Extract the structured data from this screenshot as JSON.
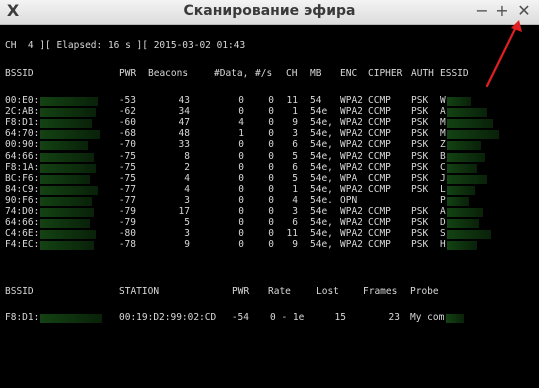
{
  "window": {
    "title": "Сканирование эфира",
    "app_icon": "X",
    "minimize": "−",
    "maximize": "+",
    "close": "✕"
  },
  "status_line": "CH  4 ][ Elapsed: 16 s ][ 2015-03-02 01:43",
  "ap_table": {
    "headers": [
      "BSSID",
      "PWR",
      "Beacons",
      "#Data,",
      "#/s",
      "CH",
      "MB",
      "ENC",
      "CIPHER",
      "AUTH",
      "ESSID"
    ],
    "rows": [
      {
        "bssid": "00:E0:",
        "pwr": "-53",
        "beacons": "43",
        "data": "0",
        "ps": "0",
        "ch": "11",
        "mb": "54",
        "enc": "WPA2",
        "cipher": "CCMP",
        "auth": "PSK",
        "essid": "W"
      },
      {
        "bssid": "2C:AB:",
        "pwr": "-62",
        "beacons": "34",
        "data": "0",
        "ps": "0",
        "ch": "1",
        "mb": "54e",
        "enc": "WPA2",
        "cipher": "CCMP",
        "auth": "PSK",
        "essid": "A"
      },
      {
        "bssid": "F8:D1:",
        "pwr": "-60",
        "beacons": "47",
        "data": "4",
        "ps": "0",
        "ch": "9",
        "mb": "54e,",
        "enc": "WPA2",
        "cipher": "CCMP",
        "auth": "PSK",
        "essid": "M"
      },
      {
        "bssid": "64:70:",
        "pwr": "-68",
        "beacons": "48",
        "data": "1",
        "ps": "0",
        "ch": "3",
        "mb": "54e,",
        "enc": "WPA2",
        "cipher": "CCMP",
        "auth": "PSK",
        "essid": "M"
      },
      {
        "bssid": "00:90:",
        "pwr": "-70",
        "beacons": "33",
        "data": "0",
        "ps": "0",
        "ch": "6",
        "mb": "54e,",
        "enc": "WPA2",
        "cipher": "CCMP",
        "auth": "PSK",
        "essid": "Z"
      },
      {
        "bssid": "64:66:",
        "pwr": "-75",
        "beacons": "8",
        "data": "0",
        "ps": "0",
        "ch": "5",
        "mb": "54e,",
        "enc": "WPA2",
        "cipher": "CCMP",
        "auth": "PSK",
        "essid": "B"
      },
      {
        "bssid": "F8:1A:",
        "pwr": "-75",
        "beacons": "2",
        "data": "0",
        "ps": "0",
        "ch": "6",
        "mb": "54e,",
        "enc": "WPA2",
        "cipher": "CCMP",
        "auth": "PSK",
        "essid": "C"
      },
      {
        "bssid": "BC:F6:",
        "pwr": "-75",
        "beacons": "4",
        "data": "0",
        "ps": "0",
        "ch": "5",
        "mb": "54e,",
        "enc": "WPA",
        "cipher": "CCMP",
        "auth": "PSK",
        "essid": "J"
      },
      {
        "bssid": "84:C9:",
        "pwr": "-77",
        "beacons": "4",
        "data": "0",
        "ps": "0",
        "ch": "1",
        "mb": "54e,",
        "enc": "WPA2",
        "cipher": "CCMP",
        "auth": "PSK",
        "essid": "L"
      },
      {
        "bssid": "90:F6:",
        "pwr": "-77",
        "beacons": "3",
        "data": "0",
        "ps": "0",
        "ch": "4",
        "mb": "54e.",
        "enc": "OPN",
        "cipher": "",
        "auth": "",
        "essid": "P"
      },
      {
        "bssid": "74:D0:",
        "pwr": "-79",
        "beacons": "17",
        "data": "0",
        "ps": "0",
        "ch": "3",
        "mb": "54e",
        "enc": "WPA2",
        "cipher": "CCMP",
        "auth": "PSK",
        "essid": "A"
      },
      {
        "bssid": "64:66:",
        "pwr": "-79",
        "beacons": "5",
        "data": "0",
        "ps": "0",
        "ch": "6",
        "mb": "54e,",
        "enc": "WPA2",
        "cipher": "CCMP",
        "auth": "PSK",
        "essid": "D"
      },
      {
        "bssid": "C4:6E:",
        "pwr": "-80",
        "beacons": "3",
        "data": "0",
        "ps": "0",
        "ch": "11",
        "mb": "54e,",
        "enc": "WPA2",
        "cipher": "CCMP",
        "auth": "PSK",
        "essid": "S"
      },
      {
        "bssid": "F4:EC:",
        "pwr": "-78",
        "beacons": "9",
        "data": "0",
        "ps": "0",
        "ch": "9",
        "mb": "54e,",
        "enc": "WPA2",
        "cipher": "CCMP",
        "auth": "PSK",
        "essid": "H"
      }
    ]
  },
  "station_table": {
    "headers": [
      "BSSID",
      "STATION",
      "PWR",
      "Rate",
      "Lost",
      "Frames",
      "Probe"
    ],
    "rows": [
      {
        "bssid": "F8:D1:",
        "station": "00:19:D2:99:02:CD",
        "pwr": "-54",
        "rate": "0 - 1e",
        "lost": "15",
        "frames": "23",
        "probe": "My com"
      }
    ]
  },
  "colors": {
    "terminal_bg": "#000000",
    "terminal_text": "#d8d8d8",
    "redaction": "#1e5a1e",
    "annotation_arrow": "#e02020"
  },
  "annotation": {
    "type": "arrow",
    "points_to": "close-button"
  }
}
